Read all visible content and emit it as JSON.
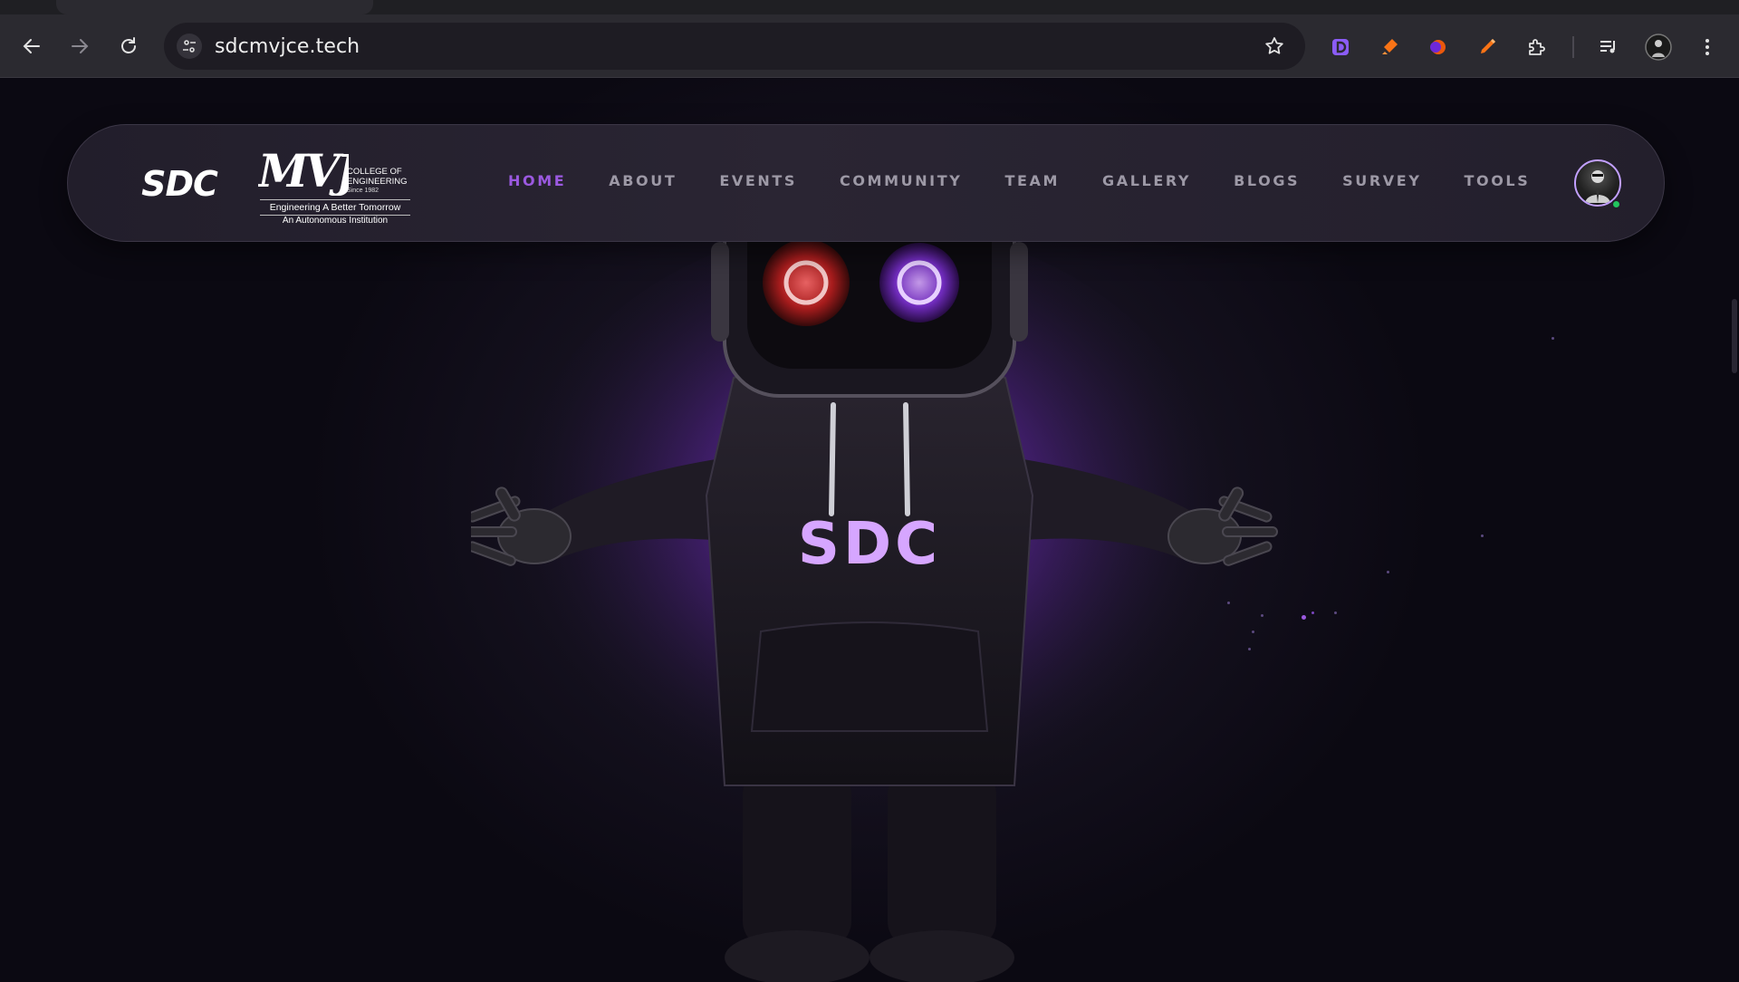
{
  "browser": {
    "url": "sdcmvjce.tech",
    "icons": {
      "back": "arrow-left-icon",
      "forward": "arrow-right-icon",
      "reload": "reload-icon",
      "site_info": "tune-icon",
      "bookmark": "star-icon",
      "extensions": [
        "d-extension-icon",
        "highlighter-extension-icon",
        "orange-orb-extension-icon",
        "pen-extension-icon",
        "puzzle-icon"
      ],
      "media": "media-queue-icon",
      "profile": "profile-avatar-icon",
      "menu": "kebab-menu-icon"
    }
  },
  "navbar": {
    "logo_sdc": "SDC",
    "logo_mvj": {
      "mark": "MVJ",
      "college_line1": "COLLEGE OF",
      "college_line2": "ENGINEERING",
      "since": "Since 1982",
      "tagline": "Engineering A Better Tomorrow",
      "subtitle": "An Autonomous Institution"
    },
    "links": [
      {
        "label": "HOME",
        "active": true
      },
      {
        "label": "ABOUT",
        "active": false
      },
      {
        "label": "EVENTS",
        "active": false
      },
      {
        "label": "COMMUNITY",
        "active": false
      },
      {
        "label": "TEAM",
        "active": false
      },
      {
        "label": "GALLERY",
        "active": false
      },
      {
        "label": "BLOGS",
        "active": false
      },
      {
        "label": "SURVEY",
        "active": false
      },
      {
        "label": "TOOLS",
        "active": false
      }
    ],
    "status": "online"
  },
  "hero": {
    "mascot_hoodie_text": "SDC"
  },
  "colors": {
    "accent": "#9b59e0",
    "glow": "#8b3fe6",
    "background": "#0b0912",
    "online": "#22c55e",
    "eye_left": "#e23a3a",
    "eye_right": "#a25cf0"
  }
}
